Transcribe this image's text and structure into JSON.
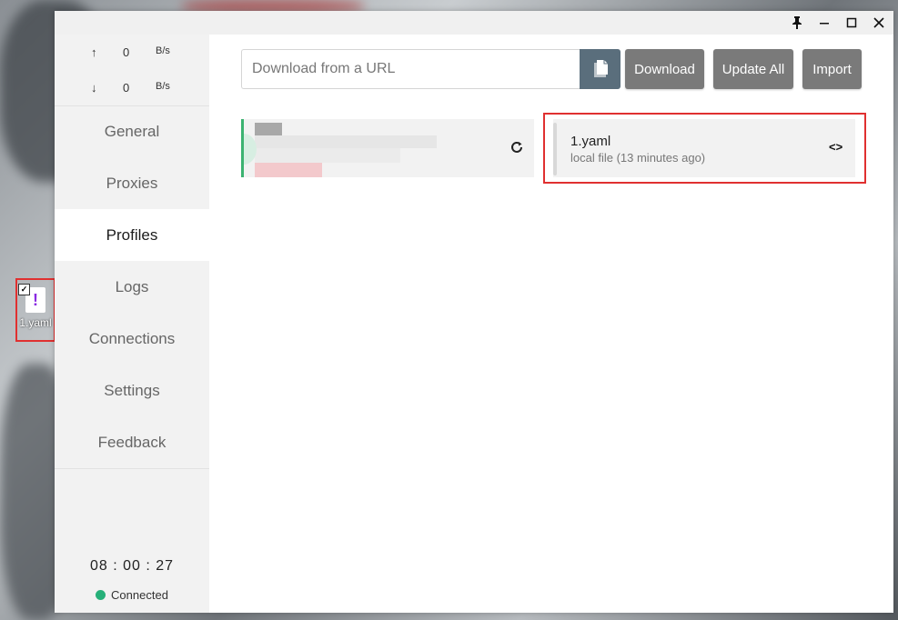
{
  "desktop": {
    "file_label": "1.yaml"
  },
  "window": {
    "controls": {
      "pin": "📌",
      "minimize": "—",
      "maximize": "☐",
      "close": "✕"
    }
  },
  "traffic": {
    "up": {
      "arrow": "↑",
      "value": "0",
      "unit": "B/s"
    },
    "down": {
      "arrow": "↓",
      "value": "0",
      "unit": "B/s"
    }
  },
  "nav": {
    "items": [
      {
        "label": "General"
      },
      {
        "label": "Proxies"
      },
      {
        "label": "Profiles"
      },
      {
        "label": "Logs"
      },
      {
        "label": "Connections"
      },
      {
        "label": "Settings"
      },
      {
        "label": "Feedback"
      }
    ],
    "active": "Profiles"
  },
  "status": {
    "time": "08 : 00 : 27",
    "label": "Connected",
    "color": "#27b079"
  },
  "toolbar": {
    "url_placeholder": "Download from a URL",
    "url_value": "",
    "paste_icon": "paste-icon",
    "download_label": "Download",
    "update_all_label": "Update All",
    "import_label": "Import"
  },
  "profiles": [
    {
      "name": "",
      "subtitle": "",
      "blurred": true,
      "selected": true,
      "icon": "refresh-icon"
    },
    {
      "name": "1.yaml",
      "subtitle": "local file (13 minutes ago)",
      "blurred": false,
      "selected": false,
      "icon": "code-icon",
      "edit_glyph": "<>"
    }
  ],
  "colors": {
    "accent": "#5a6e7c",
    "button": "#7a7a7a",
    "selected": "#3cb371",
    "highlight": "#e03030"
  }
}
